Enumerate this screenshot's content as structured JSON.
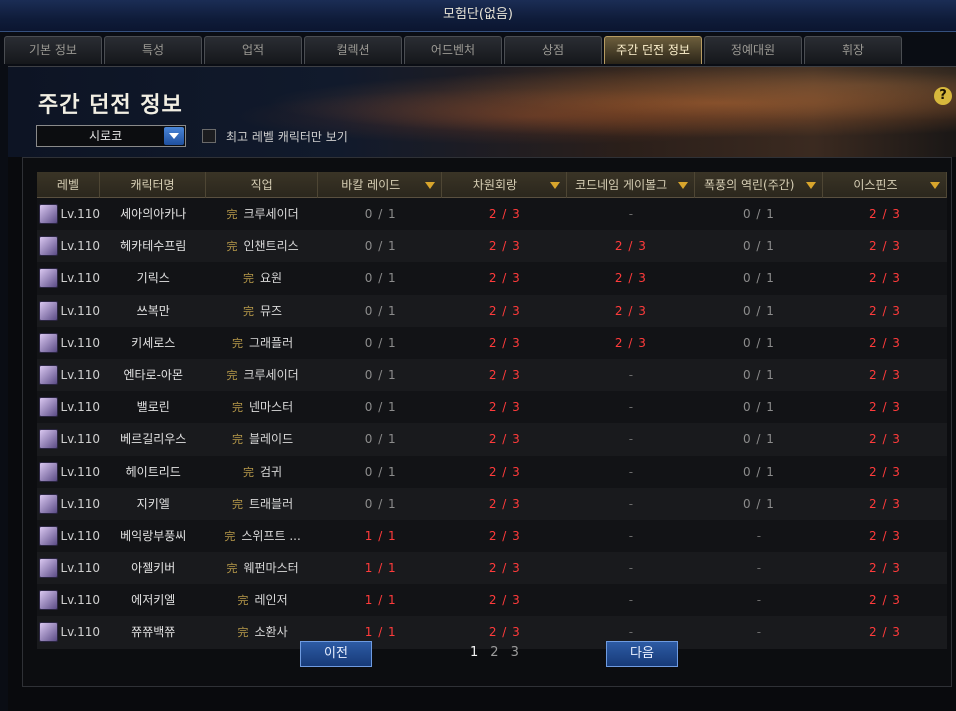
{
  "window": {
    "title": "모험단(없음)"
  },
  "tabs": [
    {
      "label": "기본 정보",
      "active": false
    },
    {
      "label": "특성",
      "active": false
    },
    {
      "label": "업적",
      "active": false
    },
    {
      "label": "컬렉션",
      "active": false
    },
    {
      "label": "어드벤처",
      "active": false
    },
    {
      "label": "상점",
      "active": false
    },
    {
      "label": "주간 던전 정보",
      "active": true
    },
    {
      "label": "정예대원",
      "active": false
    },
    {
      "label": "휘장",
      "active": false
    }
  ],
  "header": {
    "title": "주간 던전 정보",
    "help_icon": "?",
    "server": "시로코",
    "checkbox_label": "최고 레벨 캐릭터만 보기"
  },
  "table": {
    "columns": [
      "레벨",
      "캐릭터명",
      "직업",
      "바칼 레이드",
      "차원회랑",
      "코드네임 게이볼그",
      "폭풍의 역린(주간)",
      "이스핀즈"
    ],
    "rows": [
      {
        "level": "Lv.110",
        "name": "세아의아카나",
        "job": "크루세이더",
        "bakal": "0 / 1",
        "dimension": "2 / 3",
        "gaebolg": "-",
        "storm": "0 / 1",
        "ispins": "2 / 3"
      },
      {
        "level": "Lv.110",
        "name": "헤카테수프림",
        "job": "인챈트리스",
        "bakal": "0 / 1",
        "dimension": "2 / 3",
        "gaebolg": "2 / 3",
        "storm": "0 / 1",
        "ispins": "2 / 3"
      },
      {
        "level": "Lv.110",
        "name": "기릭스",
        "job": "요원",
        "bakal": "0 / 1",
        "dimension": "2 / 3",
        "gaebolg": "2 / 3",
        "storm": "0 / 1",
        "ispins": "2 / 3"
      },
      {
        "level": "Lv.110",
        "name": "쓰복만",
        "job": "뮤즈",
        "bakal": "0 / 1",
        "dimension": "2 / 3",
        "gaebolg": "2 / 3",
        "storm": "0 / 1",
        "ispins": "2 / 3"
      },
      {
        "level": "Lv.110",
        "name": "키세로스",
        "job": "그래플러",
        "bakal": "0 / 1",
        "dimension": "2 / 3",
        "gaebolg": "2 / 3",
        "storm": "0 / 1",
        "ispins": "2 / 3"
      },
      {
        "level": "Lv.110",
        "name": "엔타로-아몬",
        "job": "크루세이더",
        "bakal": "0 / 1",
        "dimension": "2 / 3",
        "gaebolg": "-",
        "storm": "0 / 1",
        "ispins": "2 / 3"
      },
      {
        "level": "Lv.110",
        "name": "밸로린",
        "job": "넨마스터",
        "bakal": "0 / 1",
        "dimension": "2 / 3",
        "gaebolg": "-",
        "storm": "0 / 1",
        "ispins": "2 / 3"
      },
      {
        "level": "Lv.110",
        "name": "베르길리우스",
        "job": "블레이드",
        "bakal": "0 / 1",
        "dimension": "2 / 3",
        "gaebolg": "-",
        "storm": "0 / 1",
        "ispins": "2 / 3"
      },
      {
        "level": "Lv.110",
        "name": "헤이트리드",
        "job": "검귀",
        "bakal": "0 / 1",
        "dimension": "2 / 3",
        "gaebolg": "-",
        "storm": "0 / 1",
        "ispins": "2 / 3"
      },
      {
        "level": "Lv.110",
        "name": "지키엘",
        "job": "트래블러",
        "bakal": "0 / 1",
        "dimension": "2 / 3",
        "gaebolg": "-",
        "storm": "0 / 1",
        "ispins": "2 / 3"
      },
      {
        "level": "Lv.110",
        "name": "베익랑부풍씨",
        "job": "스위프트 ...",
        "bakal": "1 / 1",
        "dimension": "2 / 3",
        "gaebolg": "-",
        "storm": "-",
        "ispins": "2 / 3"
      },
      {
        "level": "Lv.110",
        "name": "아젤키버",
        "job": "웨펀마스터",
        "bakal": "1 / 1",
        "dimension": "2 / 3",
        "gaebolg": "-",
        "storm": "-",
        "ispins": "2 / 3"
      },
      {
        "level": "Lv.110",
        "name": "에저키엘",
        "job": "레인저",
        "bakal": "1 / 1",
        "dimension": "2 / 3",
        "gaebolg": "-",
        "storm": "-",
        "ispins": "2 / 3"
      },
      {
        "level": "Lv.110",
        "name": "쮸쮸백쮸",
        "job": "소환사",
        "bakal": "1 / 1",
        "dimension": "2 / 3",
        "gaebolg": "-",
        "storm": "-",
        "ispins": "2 / 3"
      }
    ]
  },
  "pagination": {
    "prev_label": "이전",
    "next_label": "다음",
    "pages": [
      "1",
      "2",
      "3"
    ],
    "current": "1"
  },
  "icons": {
    "job_icon": "glyph-badge",
    "sort_icon": "triangle-down",
    "select_arrow": "chevron-down"
  }
}
